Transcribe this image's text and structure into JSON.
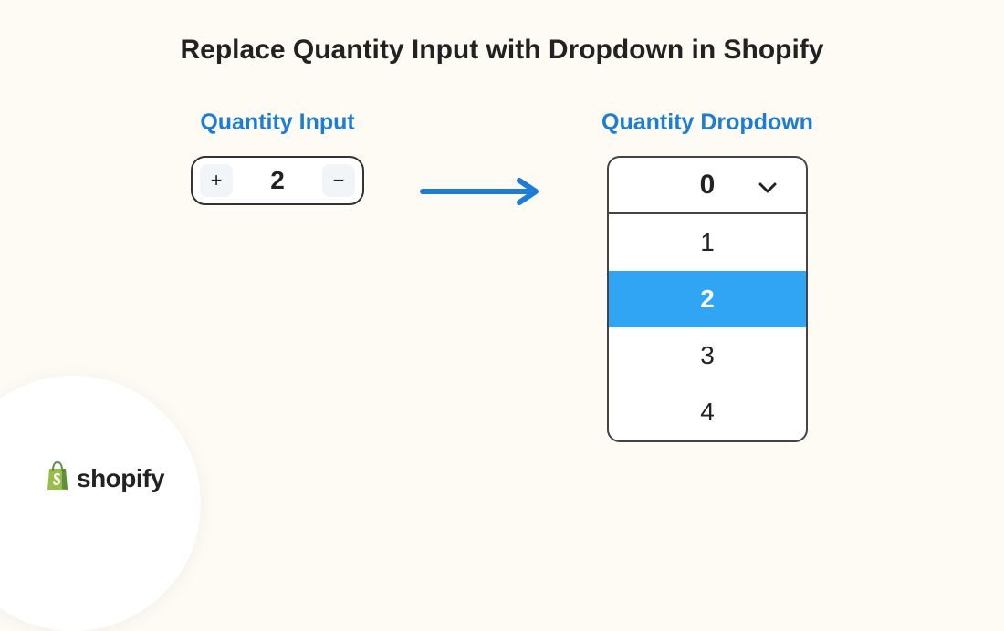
{
  "title": "Replace Quantity Input with Dropdown in Shopify",
  "input": {
    "label": "Quantity Input",
    "plus": "+",
    "value": "2",
    "minus": "−"
  },
  "dropdown": {
    "label": "Quantity Dropdown",
    "selected": "0",
    "options": [
      "1",
      "2",
      "3",
      "4"
    ],
    "highlighted": "2"
  },
  "brand": {
    "name": "shopify"
  },
  "colors": {
    "accent": "#1c7cd6",
    "highlight": "#2fa5f4",
    "brand": "#95bf47"
  }
}
